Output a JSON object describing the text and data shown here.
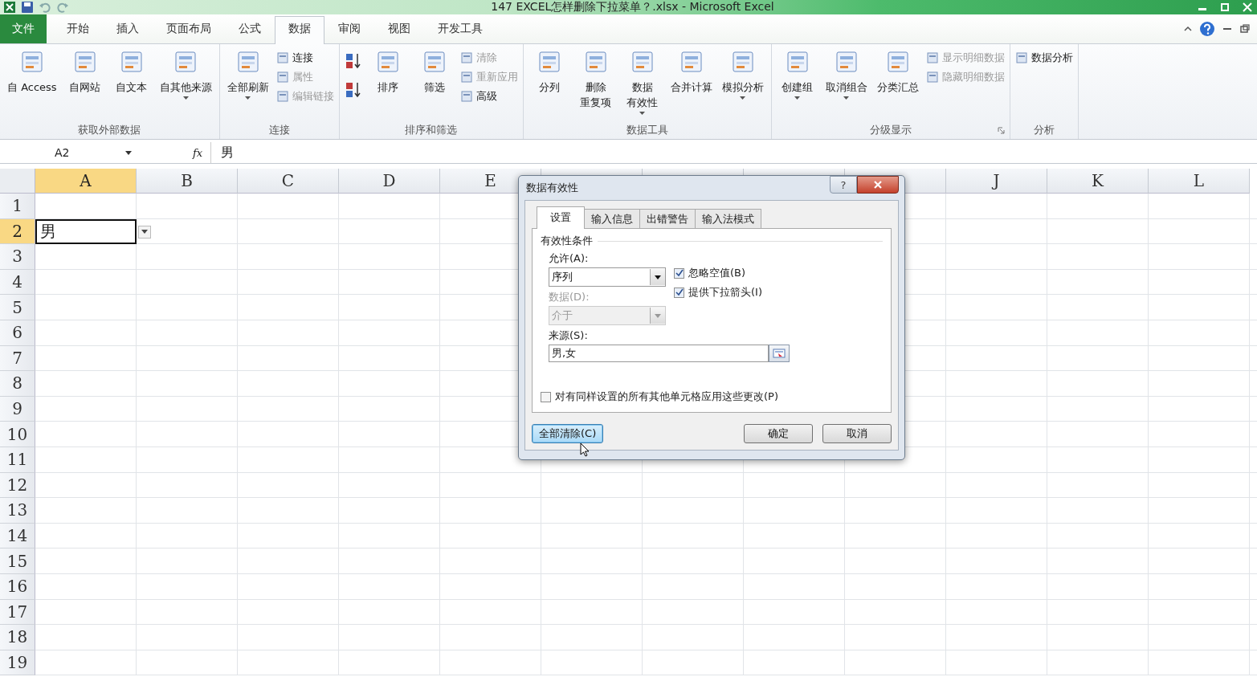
{
  "title_bar": {
    "title": "147 EXCEL怎样删除下拉菜单？.xlsx  -  Microsoft Excel"
  },
  "ribbon_tabs": [
    {
      "label": "文件",
      "kind": "file",
      "selected": false
    },
    {
      "label": "开始",
      "kind": "tab",
      "selected": false
    },
    {
      "label": "插入",
      "kind": "tab",
      "selected": false
    },
    {
      "label": "页面布局",
      "kind": "tab",
      "selected": false
    },
    {
      "label": "公式",
      "kind": "tab",
      "selected": false
    },
    {
      "label": "数据",
      "kind": "tab",
      "selected": true
    },
    {
      "label": "审阅",
      "kind": "tab",
      "selected": false
    },
    {
      "label": "视图",
      "kind": "tab",
      "selected": false
    },
    {
      "label": "开发工具",
      "kind": "tab",
      "selected": false
    }
  ],
  "ribbon_groups": [
    {
      "label": "获取外部数据",
      "items": [
        {
          "kind": "large",
          "lines": [
            "自 Access"
          ],
          "disabled": false,
          "menu": false
        },
        {
          "kind": "large",
          "lines": [
            "自网站"
          ],
          "disabled": false,
          "menu": false
        },
        {
          "kind": "large",
          "lines": [
            "自文本"
          ],
          "disabled": false,
          "menu": false
        },
        {
          "kind": "large",
          "lines": [
            "自其他来源"
          ],
          "disabled": false,
          "menu": true
        }
      ]
    },
    {
      "label": "连接",
      "items": [
        {
          "kind": "large",
          "lines": [
            "全部刷新"
          ],
          "disabled": false,
          "menu": true
        },
        {
          "kind": "stack",
          "children": [
            {
              "label": "连接",
              "disabled": false
            },
            {
              "label": "属性",
              "disabled": true
            },
            {
              "label": "编辑链接",
              "disabled": true
            }
          ]
        }
      ]
    },
    {
      "label": "排序和筛选",
      "items": [
        {
          "kind": "sorticons"
        },
        {
          "kind": "large",
          "lines": [
            "排序"
          ],
          "disabled": false,
          "menu": false
        },
        {
          "kind": "large",
          "lines": [
            "筛选"
          ],
          "disabled": false,
          "menu": false
        },
        {
          "kind": "stack",
          "children": [
            {
              "label": "清除",
              "disabled": true
            },
            {
              "label": "重新应用",
              "disabled": true
            },
            {
              "label": "高级",
              "disabled": false
            }
          ]
        }
      ]
    },
    {
      "label": "数据工具",
      "items": [
        {
          "kind": "large",
          "lines": [
            "分列"
          ],
          "disabled": false,
          "menu": false
        },
        {
          "kind": "large",
          "lines": [
            "删除",
            "重复项"
          ],
          "disabled": false,
          "menu": false
        },
        {
          "kind": "large",
          "lines": [
            "数据",
            "有效性"
          ],
          "disabled": false,
          "menu": true
        },
        {
          "kind": "large",
          "lines": [
            "合并计算"
          ],
          "disabled": false,
          "menu": false
        },
        {
          "kind": "large",
          "lines": [
            "模拟分析"
          ],
          "disabled": false,
          "menu": true
        }
      ]
    },
    {
      "label": "分级显示",
      "launcher": true,
      "items": [
        {
          "kind": "large",
          "lines": [
            "创建组"
          ],
          "disabled": false,
          "menu": true
        },
        {
          "kind": "large",
          "lines": [
            "取消组合"
          ],
          "disabled": false,
          "menu": true
        },
        {
          "kind": "large",
          "lines": [
            "分类汇总"
          ],
          "disabled": false,
          "menu": false
        },
        {
          "kind": "stack",
          "children": [
            {
              "label": "显示明细数据",
              "disabled": true
            },
            {
              "label": "隐藏明细数据",
              "disabled": true
            }
          ]
        }
      ]
    },
    {
      "label": "分析",
      "items": [
        {
          "kind": "stack",
          "children": [
            {
              "label": "数据分析",
              "disabled": false
            }
          ]
        }
      ]
    }
  ],
  "formula_bar": {
    "name_box": "A2",
    "fx": "fx",
    "formula": "男"
  },
  "sheet": {
    "columns": [
      {
        "label": "A",
        "selected": true
      },
      {
        "label": "B",
        "selected": false
      },
      {
        "label": "C",
        "selected": false
      },
      {
        "label": "D",
        "selected": false
      },
      {
        "label": "E",
        "selected": false
      },
      {
        "selected": false
      },
      {
        "selected": false
      },
      {
        "selected": false
      },
      {
        "selected": false
      },
      {
        "label": "J",
        "selected": false
      },
      {
        "label": "K",
        "selected": false
      },
      {
        "label": "L",
        "selected": false
      }
    ],
    "rows": [
      {
        "label": "1",
        "selected": false
      },
      {
        "label": "2",
        "selected": true,
        "cells": [
          {
            "value": "男",
            "active": true,
            "dropdown": true
          }
        ]
      },
      {
        "label": "3",
        "selected": false
      },
      {
        "label": "4",
        "selected": false
      },
      {
        "label": "5",
        "selected": false
      },
      {
        "label": "6",
        "selected": false
      },
      {
        "label": "7",
        "selected": false
      },
      {
        "label": "8",
        "selected": false
      },
      {
        "label": "9",
        "selected": false
      },
      {
        "label": "10",
        "selected": false
      },
      {
        "label": "11",
        "selected": false
      },
      {
        "label": "12",
        "selected": false
      },
      {
        "label": "13",
        "selected": false
      },
      {
        "label": "14",
        "selected": false
      },
      {
        "label": "15",
        "selected": false
      },
      {
        "label": "16",
        "selected": false
      },
      {
        "label": "17",
        "selected": false
      },
      {
        "label": "18",
        "selected": false
      },
      {
        "label": "19",
        "selected": false
      }
    ]
  },
  "dialog": {
    "title": "数据有效性",
    "help": "?",
    "tabs": [
      {
        "label": "设置",
        "selected": true
      },
      {
        "label": "输入信息",
        "selected": false
      },
      {
        "label": "出错警告",
        "selected": false
      },
      {
        "label": "输入法模式",
        "selected": false
      }
    ],
    "section": "有效性条件",
    "allow": {
      "label": "允许(A):",
      "value": "序列",
      "disabled": false
    },
    "data": {
      "label": "数据(D):",
      "value": "介于",
      "disabled": true
    },
    "checks": [
      {
        "label": "忽略空值(B)",
        "checked": true
      },
      {
        "label": "提供下拉箭头(I)",
        "checked": true
      }
    ],
    "source": {
      "label": "来源(S):",
      "value": "男,女"
    },
    "apply_all": {
      "label": "对有同样设置的所有其他单元格应用这些更改(P)",
      "checked": false
    },
    "buttons": [
      {
        "label": "全部清除(C)",
        "kind": "clear",
        "focused": true
      },
      {
        "label": "确定",
        "kind": "ok",
        "focused": false
      },
      {
        "label": "取消",
        "kind": "cancel",
        "focused": false
      }
    ]
  }
}
